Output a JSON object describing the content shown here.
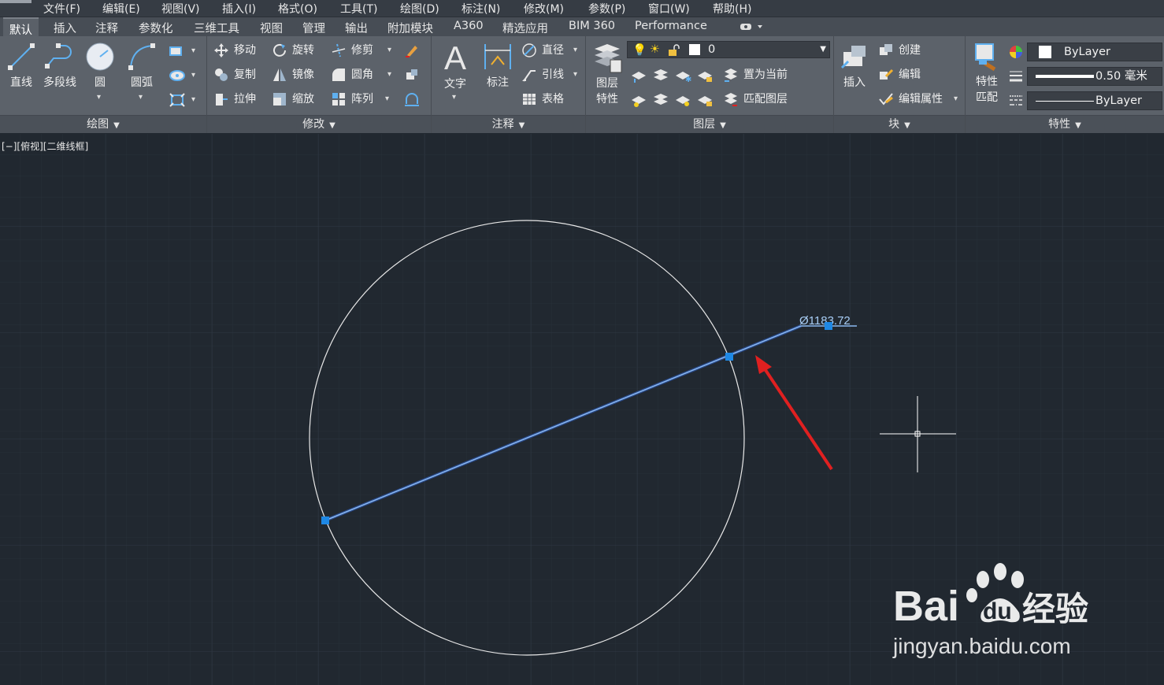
{
  "menu": [
    "文件(F)",
    "编辑(E)",
    "视图(V)",
    "插入(I)",
    "格式(O)",
    "工具(T)",
    "绘图(D)",
    "标注(N)",
    "修改(M)",
    "参数(P)",
    "窗口(W)",
    "帮助(H)"
  ],
  "tabs": [
    "默认",
    "插入",
    "注释",
    "参数化",
    "三维工具",
    "视图",
    "管理",
    "输出",
    "附加模块",
    "A360",
    "精选应用",
    "BIM 360",
    "Performance"
  ],
  "draw_panel": {
    "title": "绘图",
    "line": "直线",
    "polyline": "多段线",
    "circle": "圆",
    "arc": "圆弧"
  },
  "modify_panel": {
    "title": "修改",
    "move": "移动",
    "rotate": "旋转",
    "trim": "修剪",
    "copy": "复制",
    "mirror": "镜像",
    "fillet": "圆角",
    "stretch": "拉伸",
    "scale": "缩放",
    "array": "阵列"
  },
  "annotation_panel": {
    "title": "注释",
    "text": "文字",
    "dimension": "标注",
    "diameter": "直径",
    "leader": "引线",
    "table": "表格"
  },
  "layers_panel": {
    "title": "图层",
    "layer_properties": "图层\n特性",
    "layer_properties_l1": "图层",
    "layer_properties_l2": "特性",
    "current_layer": "0",
    "set_current": "置为当前",
    "match_layer": "匹配图层"
  },
  "block_panel": {
    "title": "块",
    "insert": "插入",
    "create": "创建",
    "edit": "编辑",
    "edit_attributes": "编辑属性"
  },
  "properties_panel": {
    "title": "特性",
    "match_l1": "特性",
    "match_l2": "匹配",
    "color": "ByLayer",
    "lineweight": "0.50 毫米",
    "linetype": "ByLayer"
  },
  "viewport_label": "[−][俯视][二维线框]",
  "drawing": {
    "dimension_text": "Ø1183.72",
    "background": "#212830",
    "circle_color": "#e8e8e8",
    "selected_color": "#4a90e2",
    "grip_color": "#1e88e5",
    "arrow_color": "#e02020"
  },
  "watermark": {
    "brand": "Bai",
    "brand2": "du",
    "product": "经验",
    "url": "jingyan.baidu.com"
  }
}
